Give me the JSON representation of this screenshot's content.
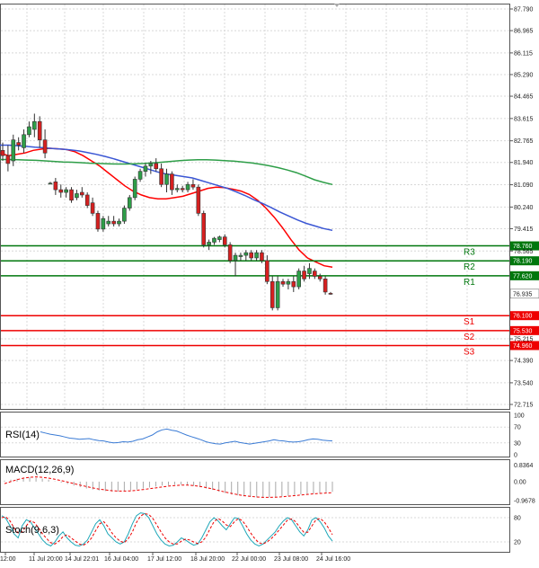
{
  "chart_data": {
    "type": "candlestick",
    "grid": true,
    "x_labels": [
      "12:00",
      "11 Jul 20:00",
      "14 Jul 22:01",
      "16 Jul 04:00",
      "17 Jul 12:00",
      "18 Jul 20:00",
      "22 Jul 00:00",
      "23 Jul 08:00",
      "24 Jul 16:00"
    ],
    "price_axis": {
      "ylim": [
        72.715,
        87.79
      ],
      "ticks": [
        "87.790",
        "86.965",
        "86.115",
        "85.290",
        "84.465",
        "83.615",
        "82.765",
        "81.940",
        "81.090",
        "80.240",
        "79.415",
        "78.565",
        "75.215",
        "74.390",
        "73.540",
        "72.715"
      ]
    },
    "candles": [
      {
        "o": 82.4,
        "h": 82.7,
        "l": 82.0,
        "c": 82.2
      },
      {
        "o": 82.2,
        "h": 82.6,
        "l": 81.6,
        "c": 81.9
      },
      {
        "o": 82.0,
        "h": 83.0,
        "l": 81.8,
        "c": 82.8
      },
      {
        "o": 82.7,
        "h": 82.9,
        "l": 82.4,
        "c": 82.6
      },
      {
        "o": 82.5,
        "h": 83.2,
        "l": 82.3,
        "c": 83.0
      },
      {
        "o": 83.0,
        "h": 83.5,
        "l": 82.9,
        "c": 83.3
      },
      {
        "o": 83.2,
        "h": 83.8,
        "l": 82.9,
        "c": 83.5
      },
      {
        "o": 83.5,
        "h": 83.7,
        "l": 82.5,
        "c": 82.8
      },
      {
        "o": 82.8,
        "h": 83.2,
        "l": 82.1,
        "c": 82.3
      },
      {
        "o": 81.15,
        "h": 81.2,
        "l": 81.1,
        "c": 81.15
      },
      {
        "o": 81.2,
        "h": 81.35,
        "l": 80.7,
        "c": 80.9
      },
      {
        "o": 80.9,
        "h": 81.1,
        "l": 80.6,
        "c": 80.8
      },
      {
        "o": 80.8,
        "h": 81.0,
        "l": 80.6,
        "c": 80.9
      },
      {
        "o": 80.9,
        "h": 81.0,
        "l": 80.4,
        "c": 80.5
      },
      {
        "o": 80.6,
        "h": 80.9,
        "l": 80.5,
        "c": 80.75
      },
      {
        "o": 80.8,
        "h": 81.0,
        "l": 80.6,
        "c": 80.7
      },
      {
        "o": 80.7,
        "h": 80.8,
        "l": 80.2,
        "c": 80.3
      },
      {
        "o": 80.4,
        "h": 80.6,
        "l": 79.9,
        "c": 80.0
      },
      {
        "o": 80.0,
        "h": 80.1,
        "l": 79.3,
        "c": 79.4
      },
      {
        "o": 79.4,
        "h": 79.9,
        "l": 79.3,
        "c": 79.8
      },
      {
        "o": 79.6,
        "h": 79.9,
        "l": 79.5,
        "c": 79.7
      },
      {
        "o": 79.7,
        "h": 79.9,
        "l": 79.5,
        "c": 79.6
      },
      {
        "o": 79.6,
        "h": 79.8,
        "l": 79.5,
        "c": 79.7
      },
      {
        "o": 79.7,
        "h": 80.3,
        "l": 79.6,
        "c": 80.2
      },
      {
        "o": 80.2,
        "h": 80.7,
        "l": 80.1,
        "c": 80.6
      },
      {
        "o": 80.6,
        "h": 81.4,
        "l": 80.5,
        "c": 81.3
      },
      {
        "o": 81.3,
        "h": 81.7,
        "l": 81.2,
        "c": 81.6
      },
      {
        "o": 81.6,
        "h": 81.9,
        "l": 81.4,
        "c": 81.8
      },
      {
        "o": 81.8,
        "h": 82.0,
        "l": 81.5,
        "c": 81.9
      },
      {
        "o": 81.9,
        "h": 82.1,
        "l": 81.6,
        "c": 81.7
      },
      {
        "o": 81.7,
        "h": 81.9,
        "l": 81.0,
        "c": 81.1
      },
      {
        "o": 81.1,
        "h": 81.7,
        "l": 80.8,
        "c": 81.5
      },
      {
        "o": 81.5,
        "h": 81.6,
        "l": 80.7,
        "c": 80.9
      },
      {
        "o": 80.9,
        "h": 81.1,
        "l": 80.8,
        "c": 80.95
      },
      {
        "o": 80.95,
        "h": 81.05,
        "l": 80.8,
        "c": 80.9
      },
      {
        "o": 80.9,
        "h": 81.2,
        "l": 80.8,
        "c": 81.1
      },
      {
        "o": 81.1,
        "h": 81.3,
        "l": 80.9,
        "c": 81.0
      },
      {
        "o": 81.0,
        "h": 81.1,
        "l": 79.9,
        "c": 80.0
      },
      {
        "o": 80.0,
        "h": 80.1,
        "l": 78.7,
        "c": 78.8
      },
      {
        "o": 78.8,
        "h": 79.0,
        "l": 78.6,
        "c": 78.9
      },
      {
        "o": 78.9,
        "h": 79.1,
        "l": 78.8,
        "c": 79.05
      },
      {
        "o": 79.0,
        "h": 79.15,
        "l": 78.9,
        "c": 79.1
      },
      {
        "o": 79.1,
        "h": 79.2,
        "l": 78.7,
        "c": 78.8
      },
      {
        "o": 78.8,
        "h": 78.9,
        "l": 78.1,
        "c": 78.2
      },
      {
        "o": 78.2,
        "h": 78.5,
        "l": 77.6,
        "c": 78.4
      },
      {
        "o": 78.35,
        "h": 78.5,
        "l": 78.2,
        "c": 78.4
      },
      {
        "o": 78.4,
        "h": 78.6,
        "l": 78.2,
        "c": 78.5
      },
      {
        "o": 78.5,
        "h": 78.6,
        "l": 78.2,
        "c": 78.3
      },
      {
        "o": 78.3,
        "h": 78.6,
        "l": 78.2,
        "c": 78.5
      },
      {
        "o": 78.5,
        "h": 78.6,
        "l": 78.1,
        "c": 78.2
      },
      {
        "o": 78.2,
        "h": 78.4,
        "l": 77.3,
        "c": 77.4
      },
      {
        "o": 77.4,
        "h": 77.6,
        "l": 76.3,
        "c": 76.4
      },
      {
        "o": 76.4,
        "h": 77.6,
        "l": 76.3,
        "c": 77.4
      },
      {
        "o": 77.4,
        "h": 77.5,
        "l": 77.2,
        "c": 77.3
      },
      {
        "o": 77.3,
        "h": 77.5,
        "l": 77.1,
        "c": 77.4
      },
      {
        "o": 77.4,
        "h": 77.6,
        "l": 77.0,
        "c": 77.2
      },
      {
        "o": 77.2,
        "h": 77.9,
        "l": 77.1,
        "c": 77.8
      },
      {
        "o": 77.8,
        "h": 78.0,
        "l": 77.4,
        "c": 77.5
      },
      {
        "o": 77.7,
        "h": 78.1,
        "l": 77.5,
        "c": 77.9
      },
      {
        "o": 77.8,
        "h": 77.9,
        "l": 77.5,
        "c": 77.6
      },
      {
        "o": 77.6,
        "h": 77.7,
        "l": 77.4,
        "c": 77.5
      },
      {
        "o": 77.5,
        "h": 77.6,
        "l": 76.9,
        "c": 77.0
      },
      {
        "o": 76.95,
        "h": 77.0,
        "l": 76.9,
        "c": 76.935
      }
    ],
    "moving_averages": [
      {
        "name": "ma-fast",
        "color": "#ff0000",
        "values": [
          82.3,
          82.2,
          82.25,
          82.3,
          82.4,
          82.45,
          82.48,
          82.46,
          82.43,
          82.35,
          82.2,
          82.0,
          81.8,
          81.55,
          81.3,
          81.05,
          80.85,
          80.7,
          80.6,
          80.55,
          80.55,
          80.6,
          80.65,
          80.75,
          80.85,
          80.95,
          81.0,
          80.98,
          80.92,
          80.85,
          80.72,
          80.5,
          80.2,
          79.85,
          79.45,
          79.0,
          78.6,
          78.3,
          78.15,
          78.0,
          77.95
        ]
      },
      {
        "name": "ma-mid",
        "color": "#3a56d4",
        "values": [
          82.6,
          82.6,
          82.58,
          82.55,
          82.52,
          82.5,
          82.47,
          82.45,
          82.42,
          82.38,
          82.32,
          82.25,
          82.17,
          82.08,
          81.98,
          81.88,
          81.78,
          81.68,
          81.58,
          81.5,
          81.45,
          81.4,
          81.35,
          81.25,
          81.15,
          81.05,
          80.95,
          80.82,
          80.68,
          80.52,
          80.38,
          80.22,
          80.05,
          79.9,
          79.75,
          79.62,
          79.52,
          79.42,
          79.35
        ]
      },
      {
        "name": "ma-slow",
        "color": "#2e9e48",
        "values": [
          82.05,
          82.05,
          82.04,
          82.03,
          82.02,
          82.0,
          81.98,
          81.96,
          81.95,
          81.93,
          81.91,
          81.9,
          81.89,
          81.88,
          81.88,
          81.89,
          81.9,
          81.92,
          81.95,
          81.98,
          82.01,
          82.03,
          82.04,
          82.04,
          82.03,
          82.01,
          81.99,
          81.96,
          81.92,
          81.87,
          81.81,
          81.74,
          81.65,
          81.55,
          81.42,
          81.28,
          81.18,
          81.1
        ]
      }
    ],
    "levels": [
      {
        "name": "R3",
        "value": 78.76,
        "label": "78.760",
        "color": "#00770d"
      },
      {
        "name": "R2",
        "value": 78.19,
        "label": "78.190",
        "color": "#00770d"
      },
      {
        "name": "R1",
        "value": 77.62,
        "label": "77.620",
        "color": "#00770d"
      },
      {
        "name": "S1",
        "value": 76.1,
        "label": "76.100",
        "color": "#ee0000"
      },
      {
        "name": "S2",
        "value": 75.53,
        "label": "75.530",
        "color": "#ee0000"
      },
      {
        "name": "S3",
        "value": 74.96,
        "label": "74.960",
        "color": "#ee0000"
      }
    ],
    "current_price": {
      "value": 76.935,
      "label": "76.935",
      "color": "#000000"
    },
    "rsi": {
      "title": "RSI(14)",
      "ticks": [
        "100",
        "70",
        "30",
        "0"
      ],
      "ylim": [
        0,
        100
      ],
      "color": "#3a7bd5",
      "values": [
        58,
        55,
        52,
        50,
        48,
        45,
        42,
        41,
        39,
        40,
        41,
        38,
        36,
        35,
        32,
        30,
        31,
        33,
        32,
        34,
        38,
        40,
        45,
        50,
        58,
        63,
        65,
        62,
        60,
        55,
        50,
        46,
        42,
        38,
        33,
        30,
        28,
        27,
        30,
        32,
        34,
        31,
        29,
        27,
        29,
        31,
        33,
        35,
        38,
        36,
        35,
        33,
        32,
        33,
        35,
        38,
        40,
        39,
        37,
        36,
        35
      ]
    },
    "macd": {
      "title": "MACD(12,26,9)",
      "ticks": [
        "0.8364",
        "0.00",
        "-0.9678"
      ],
      "ylim": [
        -1.1,
        1.0
      ],
      "signal_color": "#ee0000",
      "hist_color": "#a8a8a8",
      "hist": [
        0.05,
        0.1,
        0.15,
        0.2,
        0.22,
        0.2,
        0.15,
        0.1,
        0.02,
        -0.05,
        -0.12,
        -0.2,
        -0.28,
        -0.35,
        -0.4,
        -0.45,
        -0.48,
        -0.5,
        -0.5,
        -0.48,
        -0.45,
        -0.4,
        -0.35,
        -0.3,
        -0.25,
        -0.2,
        -0.18,
        -0.15,
        -0.15,
        -0.18,
        -0.22,
        -0.28,
        -0.35,
        -0.42,
        -0.5,
        -0.58,
        -0.65,
        -0.7,
        -0.75,
        -0.78,
        -0.8,
        -0.82,
        -0.8,
        -0.78,
        -0.75,
        -0.72,
        -0.68,
        -0.65,
        -0.62,
        -0.6,
        -0.58,
        -0.55,
        -0.52
      ],
      "signal": [
        -0.1,
        0.0,
        0.1,
        0.18,
        0.22,
        0.24,
        0.22,
        0.18,
        0.12,
        0.05,
        -0.02,
        -0.1,
        -0.18,
        -0.25,
        -0.32,
        -0.38,
        -0.42,
        -0.46,
        -0.48,
        -0.48,
        -0.47,
        -0.44,
        -0.4,
        -0.36,
        -0.32,
        -0.27,
        -0.23,
        -0.2,
        -0.18,
        -0.18,
        -0.2,
        -0.24,
        -0.3,
        -0.37,
        -0.45,
        -0.53,
        -0.6,
        -0.66,
        -0.71,
        -0.75,
        -0.78,
        -0.8,
        -0.8,
        -0.79,
        -0.77,
        -0.74,
        -0.71,
        -0.68,
        -0.65,
        -0.62,
        -0.6,
        -0.58,
        -0.56
      ]
    },
    "stoch": {
      "title": "Stoch(9,6,3)",
      "ticks": [
        "80",
        "20"
      ],
      "ylim": [
        0,
        100
      ],
      "main_color": "#1ea7b8",
      "signal_color": "#ee0000",
      "main": [
        85,
        78,
        60,
        40,
        30,
        60,
        75,
        70,
        55,
        40,
        25,
        15,
        10,
        20,
        35,
        45,
        30,
        20,
        12,
        10,
        15,
        25,
        45,
        65,
        75,
        60,
        40,
        30,
        20,
        15,
        20,
        40,
        65,
        85,
        92,
        90,
        80,
        60,
        40,
        25,
        15,
        10,
        12,
        20,
        30,
        25,
        18,
        12,
        15,
        30,
        50,
        70,
        80,
        72,
        60,
        50,
        65,
        80,
        78,
        60,
        40,
        25,
        15,
        10,
        15,
        25,
        35,
        45,
        60,
        72,
        80,
        75,
        60,
        45,
        35,
        50,
        75,
        80,
        70,
        55,
        35,
        22
      ],
      "signal": [
        80,
        82,
        72,
        55,
        42,
        45,
        60,
        72,
        68,
        55,
        40,
        28,
        18,
        15,
        22,
        33,
        38,
        30,
        22,
        15,
        12,
        18,
        30,
        48,
        65,
        70,
        58,
        42,
        30,
        22,
        18,
        28,
        45,
        68,
        84,
        90,
        88,
        78,
        62,
        45,
        30,
        20,
        15,
        15,
        22,
        27,
        25,
        20,
        16,
        20,
        32,
        52,
        70,
        78,
        72,
        62,
        58,
        70,
        78,
        72,
        58,
        42,
        28,
        18,
        15,
        20,
        28,
        38,
        50,
        62,
        74,
        77,
        70,
        56,
        44,
        44,
        60,
        75,
        78,
        70,
        55,
        38
      ]
    }
  }
}
